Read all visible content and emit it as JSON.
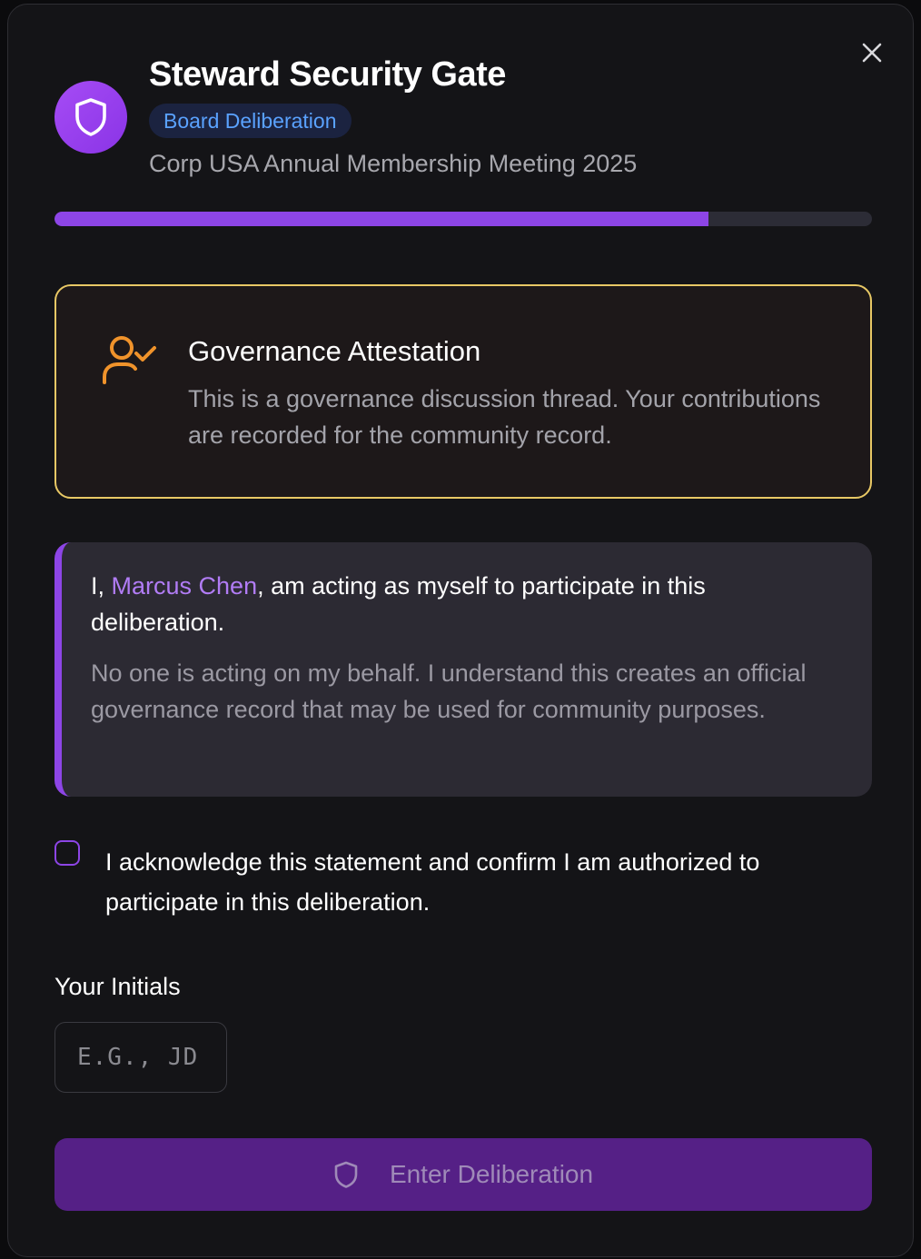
{
  "dialog": {
    "title": "Steward Security Gate",
    "badge": "Board Deliberation",
    "subtitle": "Corp USA Annual Membership Meeting 2025",
    "close_icon": "close-icon",
    "header_icon": "shield-icon",
    "progress_fraction": 0.8
  },
  "attestation": {
    "icon": "user-check-icon",
    "title": "Governance Attestation",
    "text": "This is a governance discussion thread. Your contributions are recorded for the community record."
  },
  "statement": {
    "prefix": "I, ",
    "name": "Marcus Chen",
    "suffix": ", am acting as myself to participate in this deliberation.",
    "detail": "No one is acting on my behalf. I understand this creates an official governance record that may be used for community purposes."
  },
  "acknowledgement": {
    "checked": false,
    "text": "I acknowledge this statement and confirm I am authorized to participate in this deliberation."
  },
  "initials": {
    "label": "Your Initials",
    "value": "",
    "placeholder": "E.G., JD"
  },
  "submit": {
    "icon": "shield-icon",
    "label": "Enter Deliberation"
  },
  "colors": {
    "accent": "#8d45e6",
    "badge_text": "#5aa2ff",
    "attestation_border": "#e8c865",
    "attestation_icon": "#f0932b",
    "name_highlight": "#b17cf5",
    "button_bg": "#552086"
  }
}
